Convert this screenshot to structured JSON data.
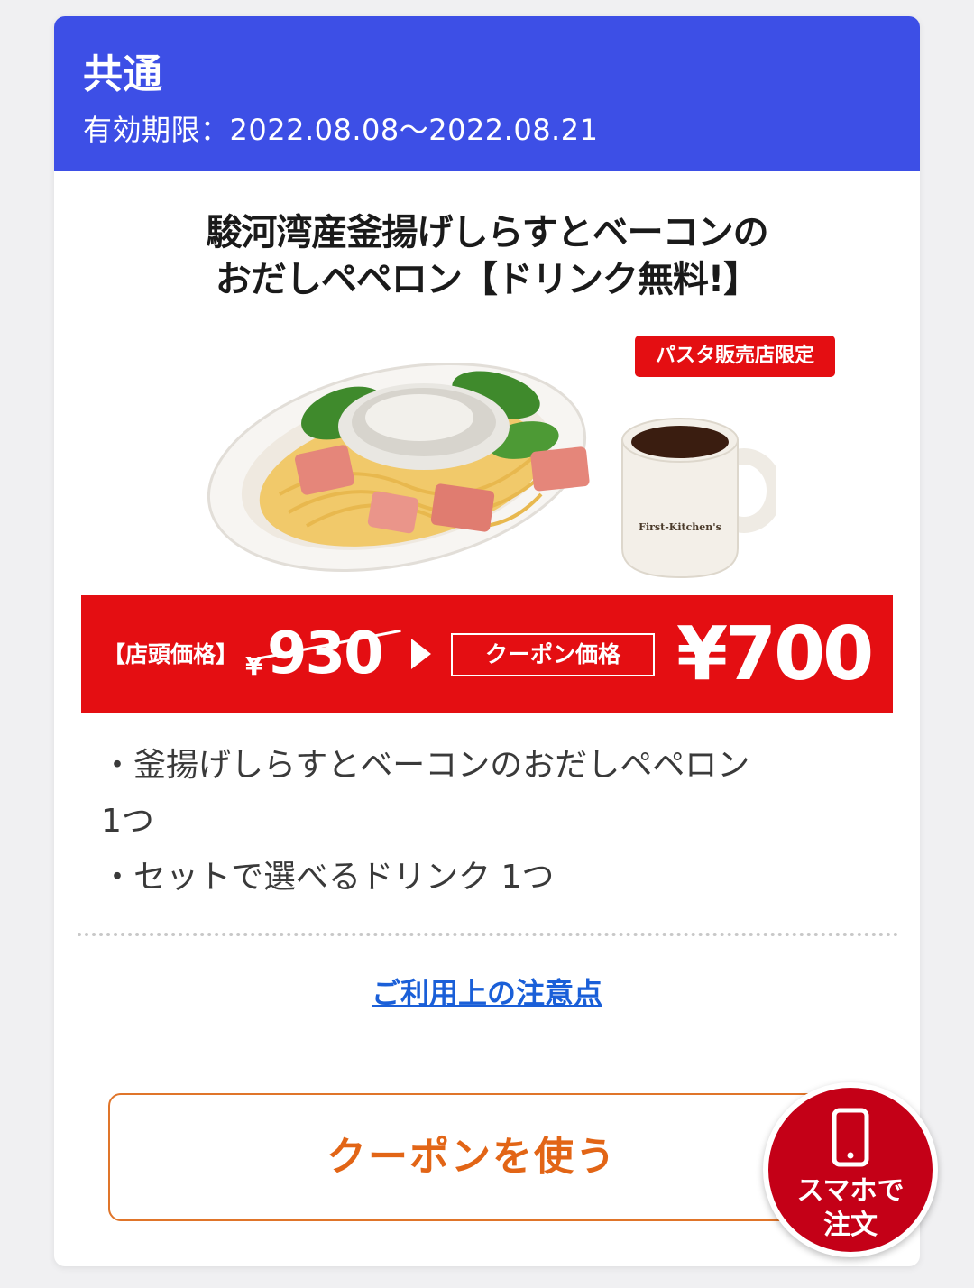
{
  "header": {
    "title": "共通",
    "validity": "有効期限：2022.08.08〜2022.08.21"
  },
  "banner": {
    "title_line1": "駿河湾産釜揚げしらすとベーコンの",
    "title_line2": "おだしペペロン【ドリンク無料!】",
    "badge": "パスタ販売店限定",
    "cup_text": "First-Kitchen's"
  },
  "price": {
    "store_label": "【店頭価格】",
    "old_yen": "¥",
    "old_price": "930",
    "coupon_label": "クーポン価格",
    "new_price": "¥700"
  },
  "items": [
    "・釜揚げしらすとベーコンのおだしペペロン",
    "1つ",
    "・セットで選べるドリンク 1つ"
  ],
  "notes_link": "ご利用上の注意点",
  "use_button": "クーポンを使う",
  "order_fab": {
    "line1": "スマホで",
    "line2": "注文"
  },
  "colors": {
    "header_bg": "#3d4fe6",
    "price_bar": "#e40e12",
    "link": "#1a5fd8",
    "button_text": "#e26516",
    "fab_bg": "#c40017"
  }
}
